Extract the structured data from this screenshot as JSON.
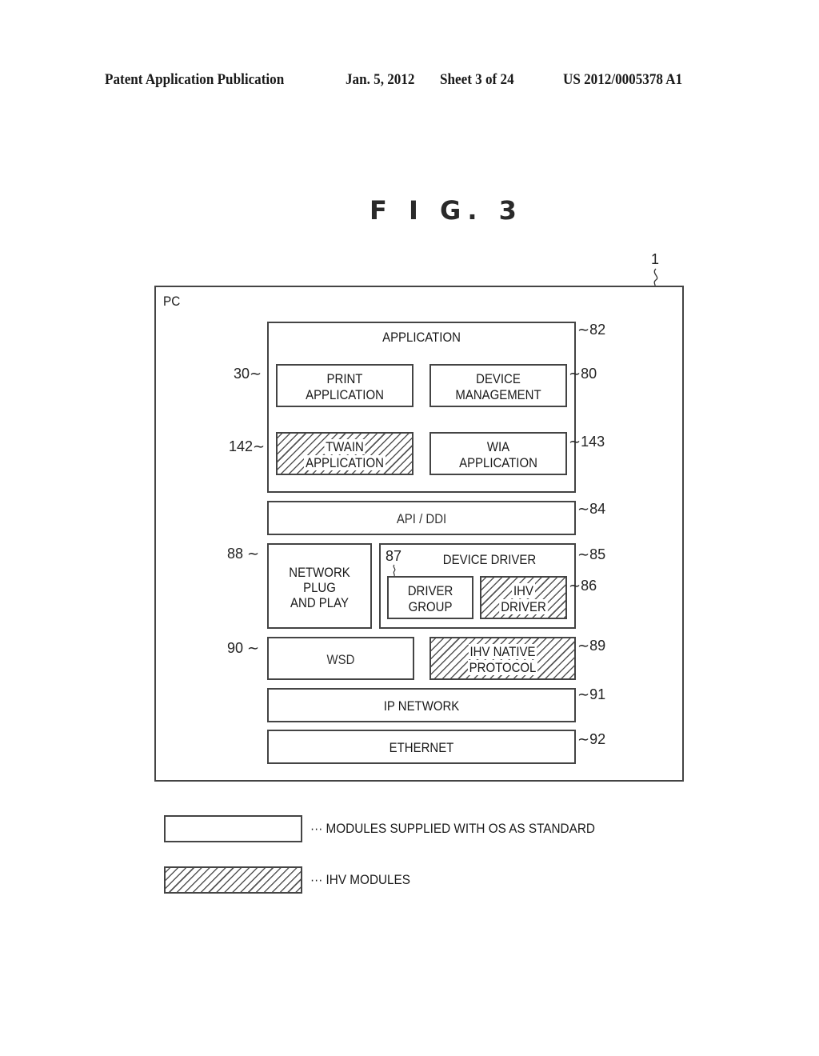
{
  "header": {
    "publication": "Patent Application Publication",
    "date": "Jan. 5, 2012",
    "sheet": "Sheet 3 of 24",
    "number": "US 2012/0005378 A1"
  },
  "figure": {
    "title": "F I G. 3",
    "outer_ref": "1",
    "pc_label": "PC"
  },
  "modules": {
    "application": {
      "label": "APPLICATION",
      "ref": "82",
      "type": "standard"
    },
    "print_application": {
      "line1": "PRINT",
      "line2": "APPLICATION",
      "ref": "30",
      "type": "standard"
    },
    "device_management": {
      "line1": "DEVICE",
      "line2": "MANAGEMENT",
      "ref": "80",
      "type": "standard"
    },
    "twain_application": {
      "line1": "TWAIN",
      "line2": "APPLICATION",
      "ref": "142",
      "type": "ihv"
    },
    "wia_application": {
      "line1": "WIA",
      "line2": "APPLICATION",
      "ref": "143",
      "type": "standard"
    },
    "api_ddi": {
      "label": "API / DDI",
      "ref": "84",
      "type": "standard"
    },
    "network_pnp": {
      "line1": "NETWORK",
      "line2": "PLUG",
      "line3": "AND PLAY",
      "ref": "88",
      "type": "standard"
    },
    "device_driver": {
      "label": "DEVICE DRIVER",
      "ref": "85",
      "type": "standard"
    },
    "driver_group": {
      "line1": "DRIVER",
      "line2": "GROUP",
      "ref": "87",
      "type": "standard"
    },
    "ihv_driver": {
      "line1": "IHV",
      "line2": "DRIVER",
      "ref": "86",
      "type": "ihv"
    },
    "wsd": {
      "label": "WSD",
      "ref": "90",
      "type": "standard"
    },
    "ihv_native_protocol": {
      "line1": "IHV NATIVE",
      "line2": "PROTOCOL",
      "ref": "89",
      "type": "ihv"
    },
    "ip_network": {
      "label": "IP NETWORK",
      "ref": "91",
      "type": "standard"
    },
    "ethernet": {
      "label": "ETHERNET",
      "ref": "92",
      "type": "standard"
    }
  },
  "legend": [
    {
      "pattern": "plain",
      "text": "··· MODULES SUPPLIED WITH OS AS STANDARD"
    },
    {
      "pattern": "hatched",
      "text": "··· IHV MODULES"
    }
  ],
  "tilde_glyph": "∼"
}
